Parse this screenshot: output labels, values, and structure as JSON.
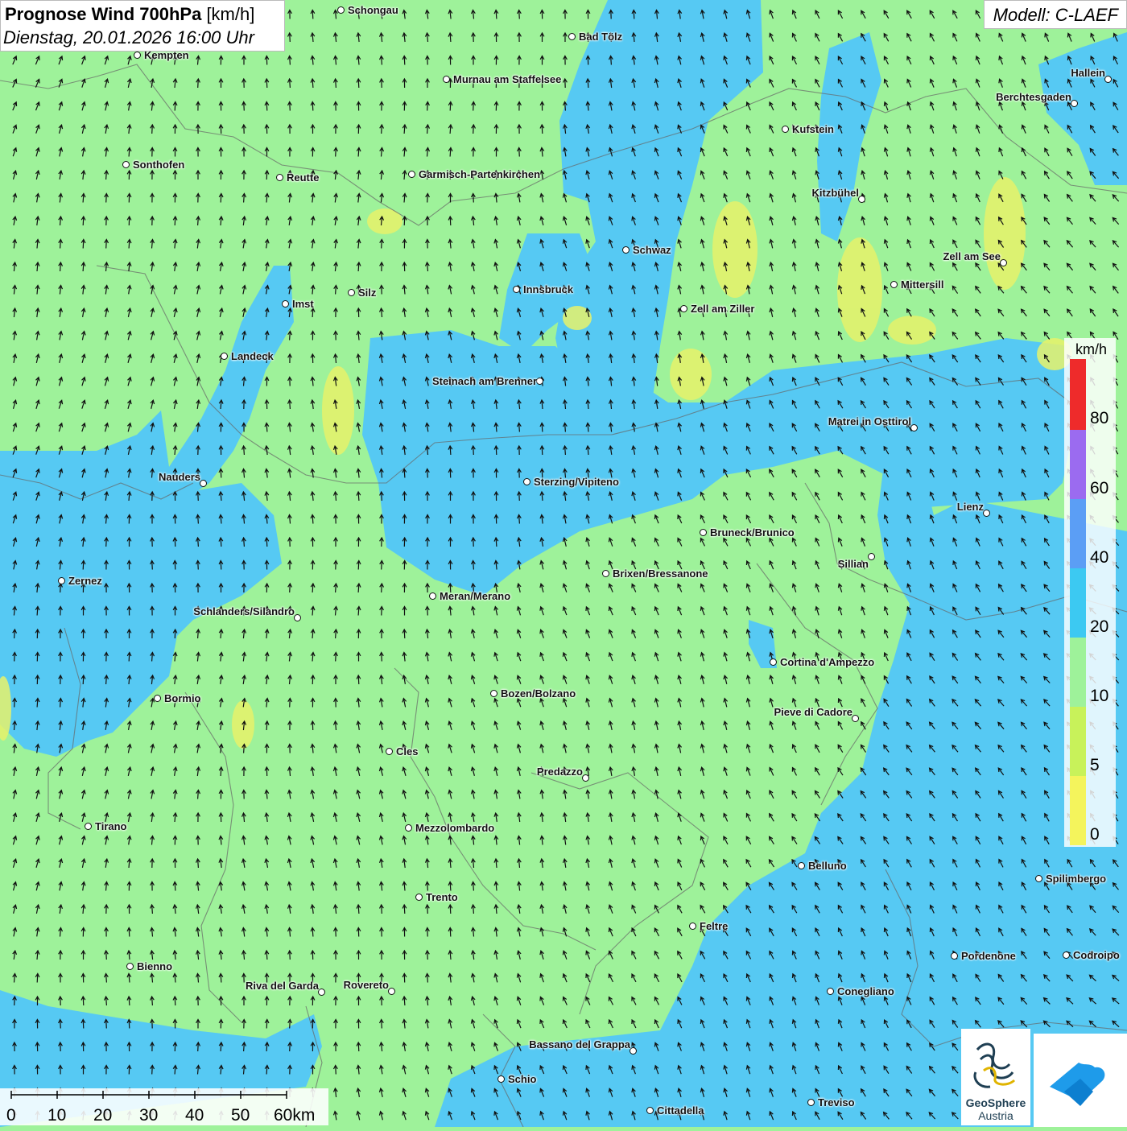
{
  "title": {
    "main": "Prognose Wind 700hPa",
    "unit": "[km/h]",
    "datetime": "Dienstag, 20.01.2026 16:00 Uhr"
  },
  "model": "Modell: C-LAEF",
  "legend": {
    "unit": "km/h",
    "labels": [
      "80",
      "60",
      "40",
      "20",
      "10",
      "5",
      "0"
    ],
    "colors": [
      "#ee2b2b",
      "#9b6bf0",
      "#5b9ef5",
      "#3cc9f2",
      "#9ef29a",
      "#c8f25a",
      "#f4f45c"
    ]
  },
  "scalebar": {
    "ticks": [
      "0",
      "10",
      "20",
      "30",
      "40",
      "50",
      "60km"
    ]
  },
  "logos": {
    "geosphere_line1": "GeoSphere",
    "geosphere_line2": "Austria",
    "geosphere_icon": "geosphere-logo-icon",
    "app_icon": "wetter-app-logo-icon"
  },
  "cities": [
    {
      "name": "Schongau"
    },
    {
      "name": "Bad Tölz"
    },
    {
      "name": "Kempten"
    },
    {
      "name": "Murnau am Staffelsee"
    },
    {
      "name": "Hallein"
    },
    {
      "name": "Berchtesgaden"
    },
    {
      "name": "Kufstein"
    },
    {
      "name": "Sonthofen"
    },
    {
      "name": "Reutte"
    },
    {
      "name": "Garmisch-Partenkirchen"
    },
    {
      "name": "Kitzbühel"
    },
    {
      "name": "Schwaz"
    },
    {
      "name": "Zell am See"
    },
    {
      "name": "Mittersill"
    },
    {
      "name": "Innsbruck"
    },
    {
      "name": "Silz"
    },
    {
      "name": "Imst"
    },
    {
      "name": "Zell am Ziller"
    },
    {
      "name": "Landeck"
    },
    {
      "name": "Steinach am Brenner"
    },
    {
      "name": "Matrei in Osttirol"
    },
    {
      "name": "Nauders"
    },
    {
      "name": "Sterzing/Vipiteno"
    },
    {
      "name": "Lienz"
    },
    {
      "name": "Bruneck/Brunico"
    },
    {
      "name": "Sillian"
    },
    {
      "name": "Brixen/Bressanone"
    },
    {
      "name": "Zernez"
    },
    {
      "name": "Meran/Merano"
    },
    {
      "name": "Schlanders/Silandro"
    },
    {
      "name": "Cortina d'Ampezzo"
    },
    {
      "name": "Bozen/Bolzano"
    },
    {
      "name": "Bormio"
    },
    {
      "name": "Pieve di Cadore"
    },
    {
      "name": "Cles"
    },
    {
      "name": "Predazzo"
    },
    {
      "name": "Tirano"
    },
    {
      "name": "Mezzolombardo"
    },
    {
      "name": "Belluno"
    },
    {
      "name": "Spilimbergo"
    },
    {
      "name": "Trento"
    },
    {
      "name": "Feltre"
    },
    {
      "name": "Pordenone"
    },
    {
      "name": "Codroipo"
    },
    {
      "name": "Bienno"
    },
    {
      "name": "Riva del Garda"
    },
    {
      "name": "Rovereto"
    },
    {
      "name": "Conegliano"
    },
    {
      "name": "Bassano del Grappa"
    },
    {
      "name": "Schio"
    },
    {
      "name": "Treviso"
    },
    {
      "name": "Cittadella"
    }
  ]
}
